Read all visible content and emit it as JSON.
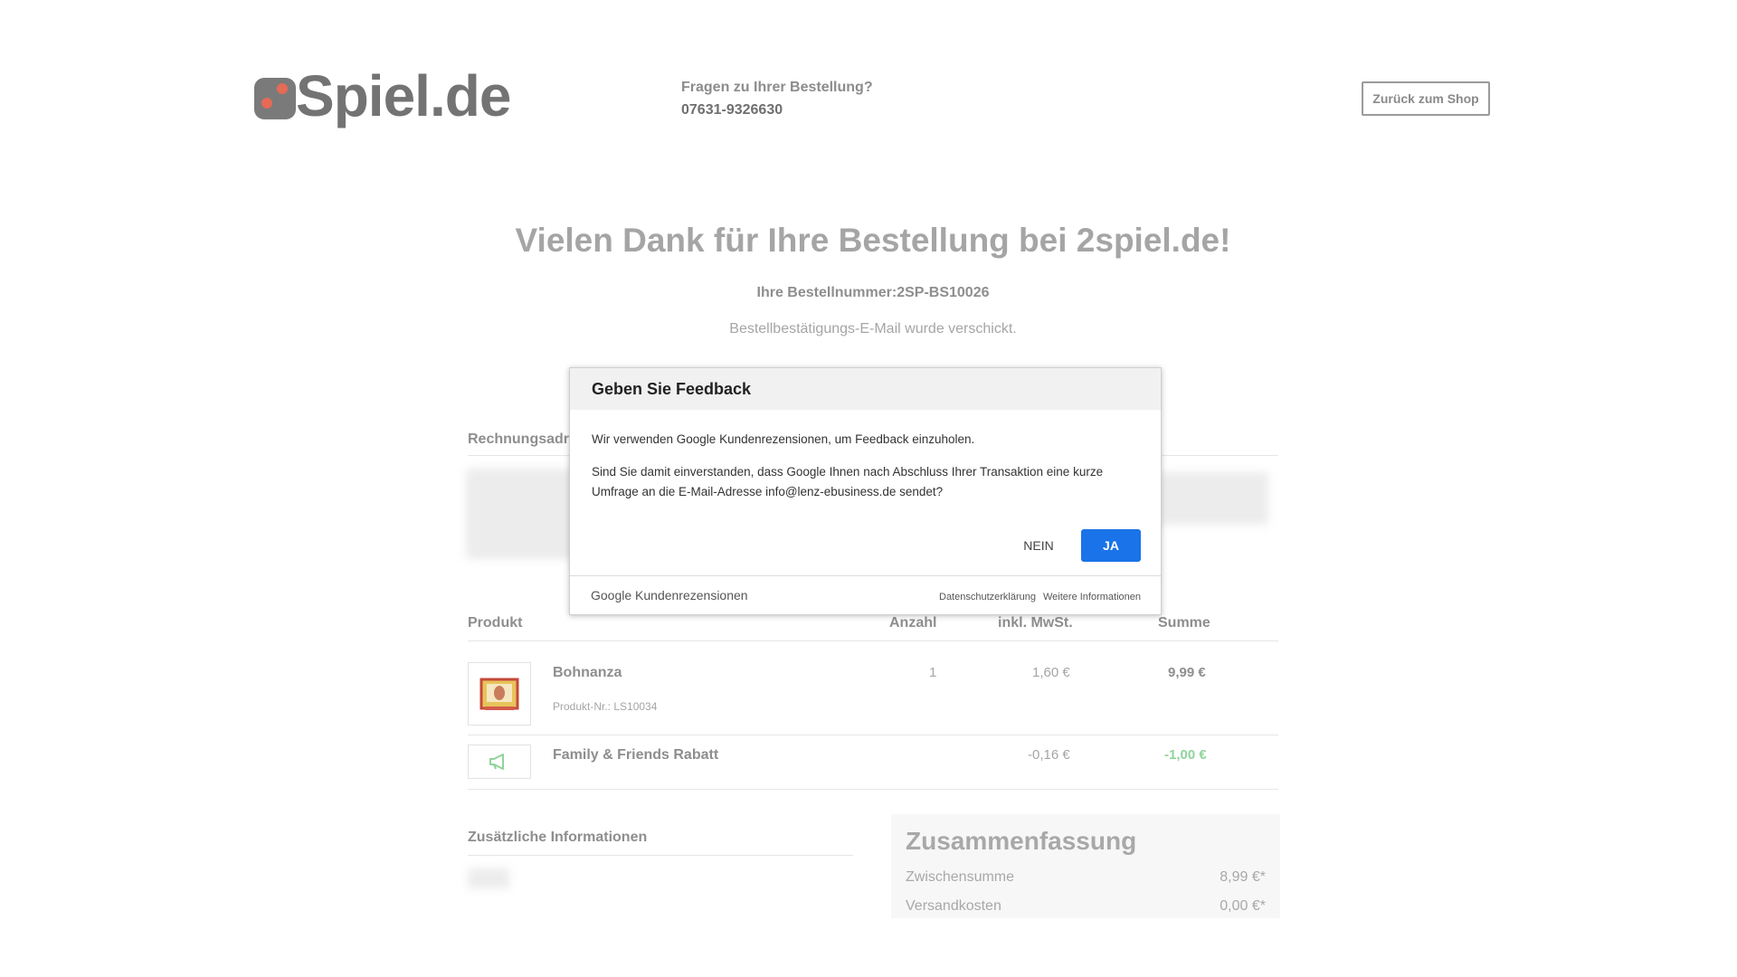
{
  "header": {
    "logo_text": "Spiel.de",
    "questions_label": "Fragen zu Ihrer Bestellung?",
    "phone": "07631-9326630",
    "back_button": "Zurück zum Shop"
  },
  "confirmation": {
    "title": "Vielen Dank für Ihre Bestellung bei 2spiel.de!",
    "order_number_line": "Ihre Bestellnummer:2SP-BS10026",
    "email_notice": "Bestellbestätigungs-E-Mail wurde verschickt."
  },
  "billing": {
    "heading": "Rechnungsadr"
  },
  "table": {
    "headers": [
      "Produkt",
      "Anzahl",
      "inkl. MwSt.",
      "Summe"
    ],
    "rows": [
      {
        "name": "Bohnanza",
        "sku": "Produkt-Nr.: LS10034",
        "qty": "1",
        "vat": "1,60 €",
        "sum": "9,99 €"
      },
      {
        "name": "Family & Friends Rabatt",
        "sku": "",
        "qty": "",
        "vat": "-0,16 €",
        "sum": "-1,00 €"
      }
    ]
  },
  "additional_info": {
    "heading": "Zusätzliche Informationen"
  },
  "summary": {
    "title": "Zusammenfassung",
    "rows": [
      {
        "label": "Zwischensumme",
        "value": "8,99 €*"
      },
      {
        "label": "Versandkosten",
        "value": "0,00 €*"
      }
    ]
  },
  "modal": {
    "title": "Geben Sie Feedback",
    "text1": "Wir verwenden Google Kundenrezensionen, um Feedback einzuholen.",
    "text2": "Sind Sie damit einverstanden, dass Google Ihnen nach Abschluss Ihrer Transaktion eine kurze Umfrage an die E-Mail-Adresse info@lenz-ebusiness.de sendet?",
    "no_button": "NEIN",
    "yes_button": "JA",
    "brand": "Google Kundenrezensionen",
    "privacy_link": "Datenschutzerklärung",
    "more_info_link": "Weitere Informationen"
  },
  "colors": {
    "primary_blue": "#1a73e8",
    "discount_green": "#8fd49b",
    "logo_orange": "#e66a55"
  }
}
